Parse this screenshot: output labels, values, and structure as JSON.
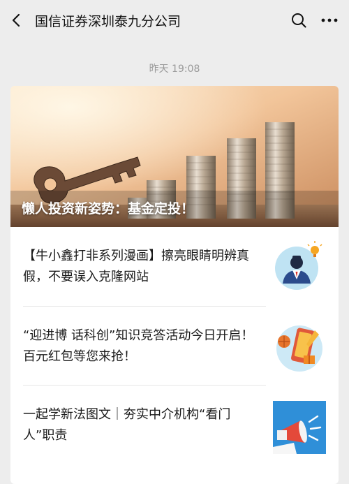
{
  "header": {
    "title": "国信证券深圳泰九分公司",
    "back_icon": "chevron-left-icon",
    "search_icon": "search-icon",
    "more_icon": "more-dots-icon"
  },
  "timestamp": "昨天 19:08",
  "hero": {
    "caption": "懒人投资新姿势：基金定投！"
  },
  "articles": [
    {
      "title": "【牛小鑫打非系列漫画】擦亮眼睛明辨真假，不要误入克隆网站",
      "thumb_icon": "businessman-icon"
    },
    {
      "title": "“迎进博 话科创”知识竞答活动今日开启！百元红包等您来抢！",
      "thumb_icon": "phone-gift-icon"
    },
    {
      "title": "一起学新法图文｜夯实中介机构“看门人”职责",
      "thumb_icon": "megaphone-icon"
    }
  ],
  "colors": {
    "background": "#ededed",
    "card": "#ffffff",
    "megaphone_bg": "#2f8fd8"
  }
}
